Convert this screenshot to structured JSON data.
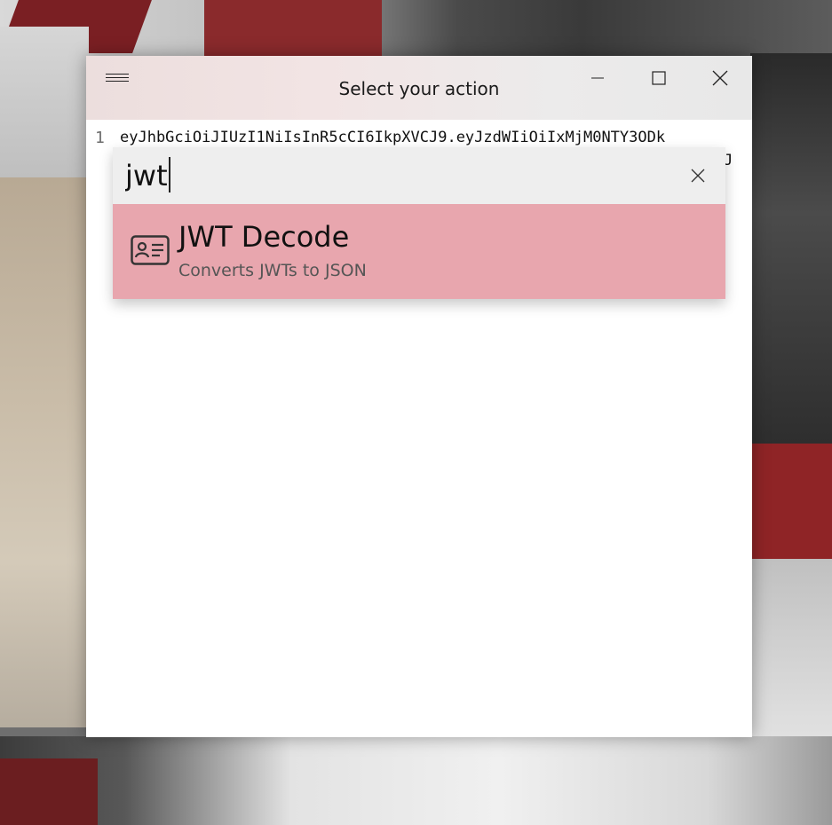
{
  "window": {
    "title": "Select your action",
    "colors": {
      "titlebar": "#ece6e6",
      "accent_highlight": "#e8a6ae"
    }
  },
  "editor": {
    "line_number": "1",
    "code_line": "eyJhbGciOiJIUzI1NiIsInR5cCI6IkpXVCJ9.eyJzdWIiOiIxMjM0NTY3ODk",
    "wrapped_tail": "J"
  },
  "palette": {
    "search": {
      "value": "jwt"
    },
    "results": [
      {
        "title": "JWT Decode",
        "subtitle": "Converts JWTs to JSON",
        "icon": "id-card-icon"
      }
    ]
  },
  "icons": {
    "menu": "hamburger-menu-icon",
    "minimize": "minimize-icon",
    "maximize": "maximize-icon",
    "close": "close-icon",
    "clear": "clear-search-icon"
  }
}
